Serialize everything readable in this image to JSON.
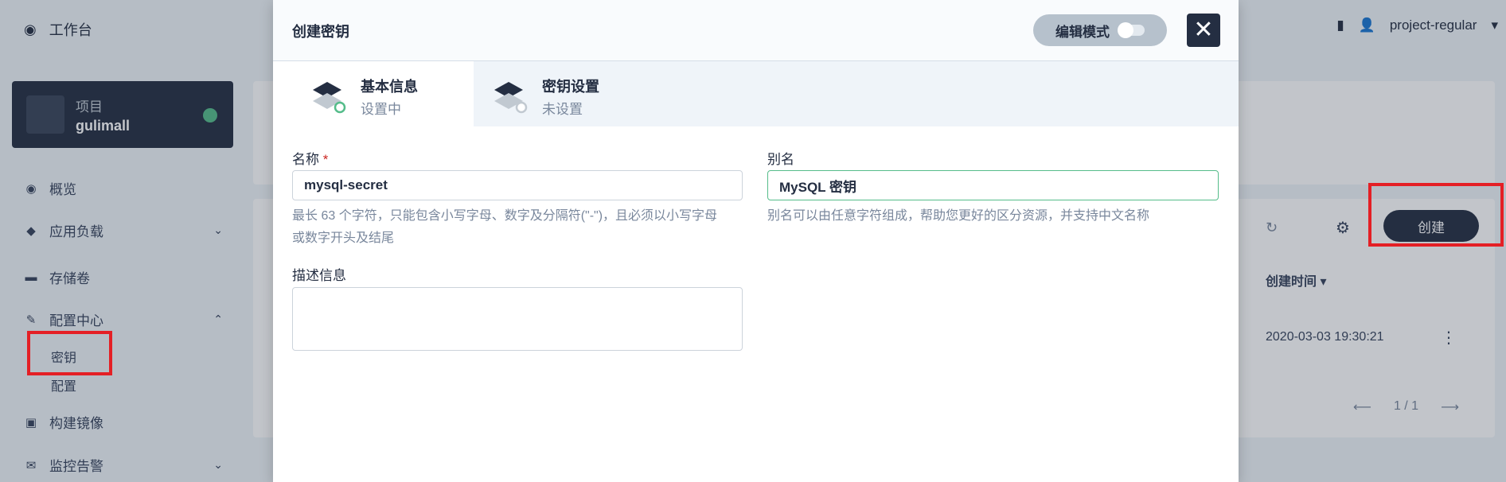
{
  "topbar": {
    "workbench": "工作台",
    "user": "project-regular"
  },
  "project": {
    "label": "项目",
    "name": "gulimall"
  },
  "nav": {
    "overview": "概览",
    "workloads": "应用负载",
    "volumes": "存储卷",
    "config_center": "配置中心",
    "secrets": "密钥",
    "configmaps": "配置",
    "image_builder": "构建镜像",
    "monitoring": "监控告警"
  },
  "list": {
    "create_label": "创建",
    "column_created": "创建时间",
    "row_time": "2020-03-03 19:30:21",
    "pager": "1 / 1"
  },
  "modal": {
    "title": "创建密钥",
    "edit_mode": "编辑模式",
    "tabs": [
      {
        "title": "基本信息",
        "status": "设置中"
      },
      {
        "title": "密钥设置",
        "status": "未设置"
      }
    ],
    "form": {
      "name_label": "名称",
      "name_required": "*",
      "name_value": "mysql-secret",
      "name_hint_line1": "最长 63 个字符，只能包含小写字母、数字及分隔符(\"-\")，且必须以小写字母",
      "name_hint_line2": "或数字开头及结尾",
      "alias_label": "别名",
      "alias_value": "MySQL 密钥",
      "alias_hint": "别名可以由任意字符组成，帮助您更好的区分资源，并支持中文名称",
      "desc_label": "描述信息",
      "desc_value": ""
    }
  },
  "colors": {
    "dark": "#242e42",
    "accent": "#55bc8a",
    "highlight": "#e41f25"
  }
}
